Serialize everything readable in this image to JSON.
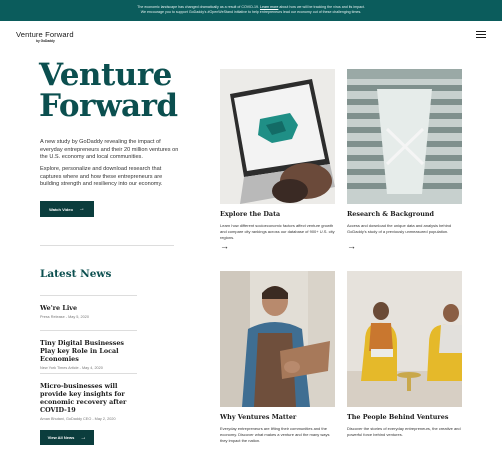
{
  "banner": {
    "line1_before": "The economic landscape has changed dramatically as a result of COVID-19.",
    "line1_link": "Learn more",
    "line1_after": "about how we will be tracking the virus and its impact.",
    "line2": "We encourage you to support GoDaddy's #OpenWeStand initiative to help entrepreneurs lead our economy out of these challenging times."
  },
  "header": {
    "logo": "Venture Forward",
    "logo_by": "by GoDaddy",
    "menu_icon": "hamburger-menu-icon"
  },
  "hero": {
    "title_line1": "Venture",
    "title_line2": "Forward",
    "paragraph1": "A new study by GoDaddy revealing the impact of everyday entrepreneurs and their 20 million ventures on the U.S. economy and local communities.",
    "paragraph2": "Explore, personalize and download research that captures where and how these entrepreneurs are building strength and resiliency into our economy.",
    "cta_label": "Watch Video"
  },
  "latest": {
    "heading": "Latest News",
    "items": [
      {
        "title": "We're Live",
        "meta": "Press Release - May 5, 2020"
      },
      {
        "title": "Tiny Digital Businesses Play key Role in Local Economies",
        "meta": "New York Times Article - May 4, 2020"
      },
      {
        "title": "Micro-businesses will provide key insights for economic recovery after COVID-19",
        "meta": "Aman Bhutani, GoDaddy CEO - May 2, 2020"
      }
    ],
    "view_all_label": "View All News"
  },
  "cards": [
    {
      "title": "Explore the Data",
      "desc": "Learn how different socioeconomic factors affect venture growth and compare city rankings across our database of 900+ U.S. city regions."
    },
    {
      "title": "Research & Background",
      "desc": "Access and download the unique data and analysis behind GoDaddy's study of a previously unmeasured population."
    },
    {
      "title": "Why Ventures Matter",
      "desc": "Everyday entrepreneurs are lifting their communities and the economy. Discover what makes a venture and the many ways they impact the nation."
    },
    {
      "title": "The People Behind Ventures",
      "desc": "Discover the stories of everyday entrepreneurs, the creative and powerful force behind ventures."
    }
  ],
  "arrow_glyph": "→",
  "colors": {
    "banner_bg": "#0b5c5c",
    "brand_teal": "#0b4f4f",
    "button_bg": "#0b3d3d"
  }
}
